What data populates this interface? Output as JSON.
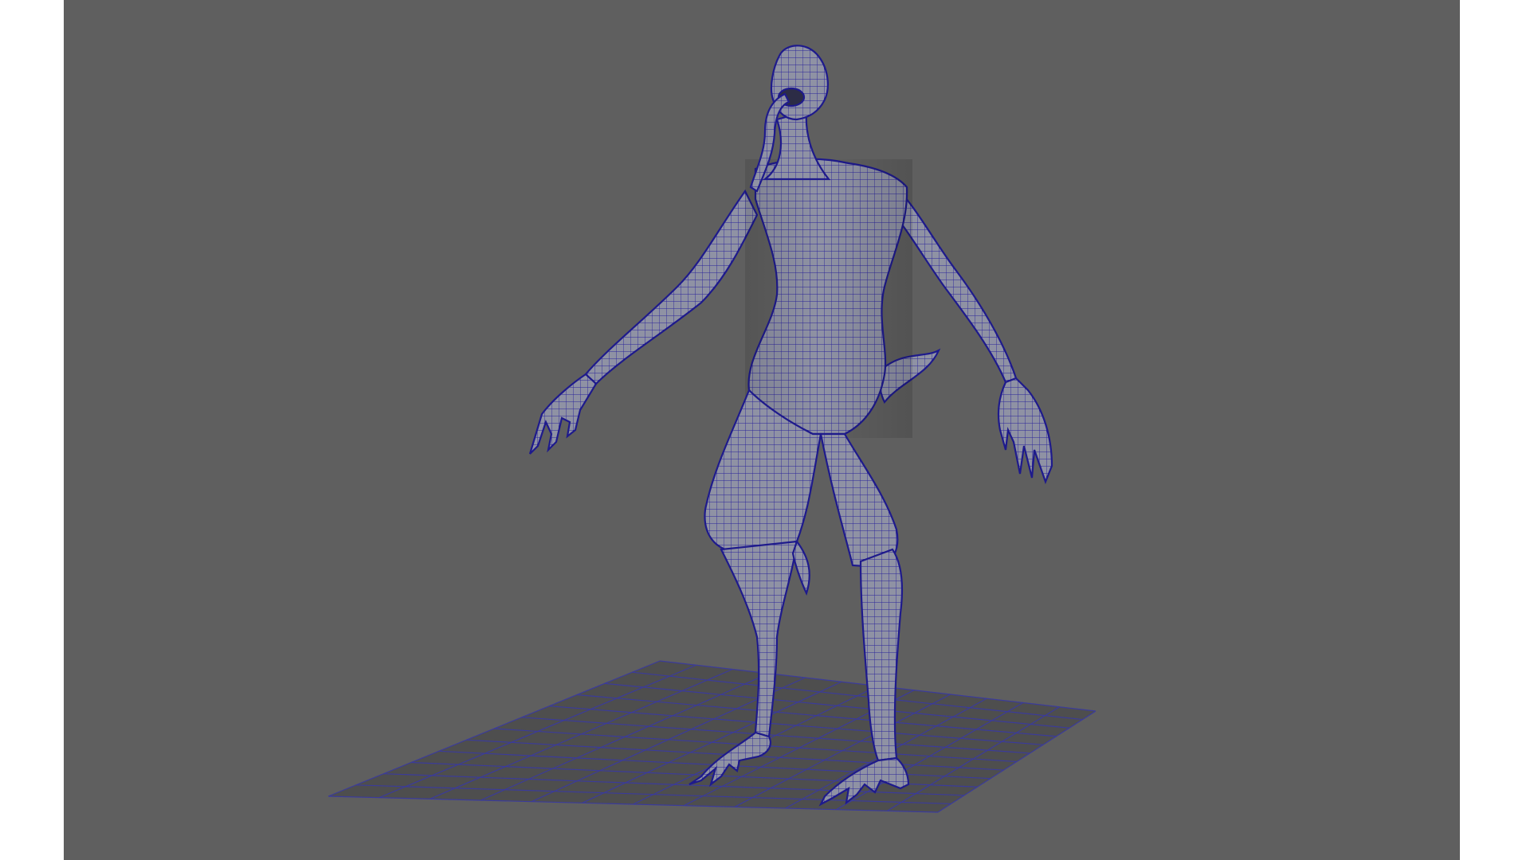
{
  "viewport": {
    "background_color": "#5f5f5f",
    "frame_color": "#ffffff",
    "view": "perspective"
  },
  "ground_grid": {
    "visible": true,
    "fill_color": "#4e4e4e",
    "line_color": "#3b3b9a",
    "divisions": 12
  },
  "model": {
    "display_mode": "shaded-with-wireframe",
    "surface_color": "#8c8fa0",
    "wire_color": "#1e1a8c",
    "icons": [
      "creature-mesh-icon"
    ]
  }
}
